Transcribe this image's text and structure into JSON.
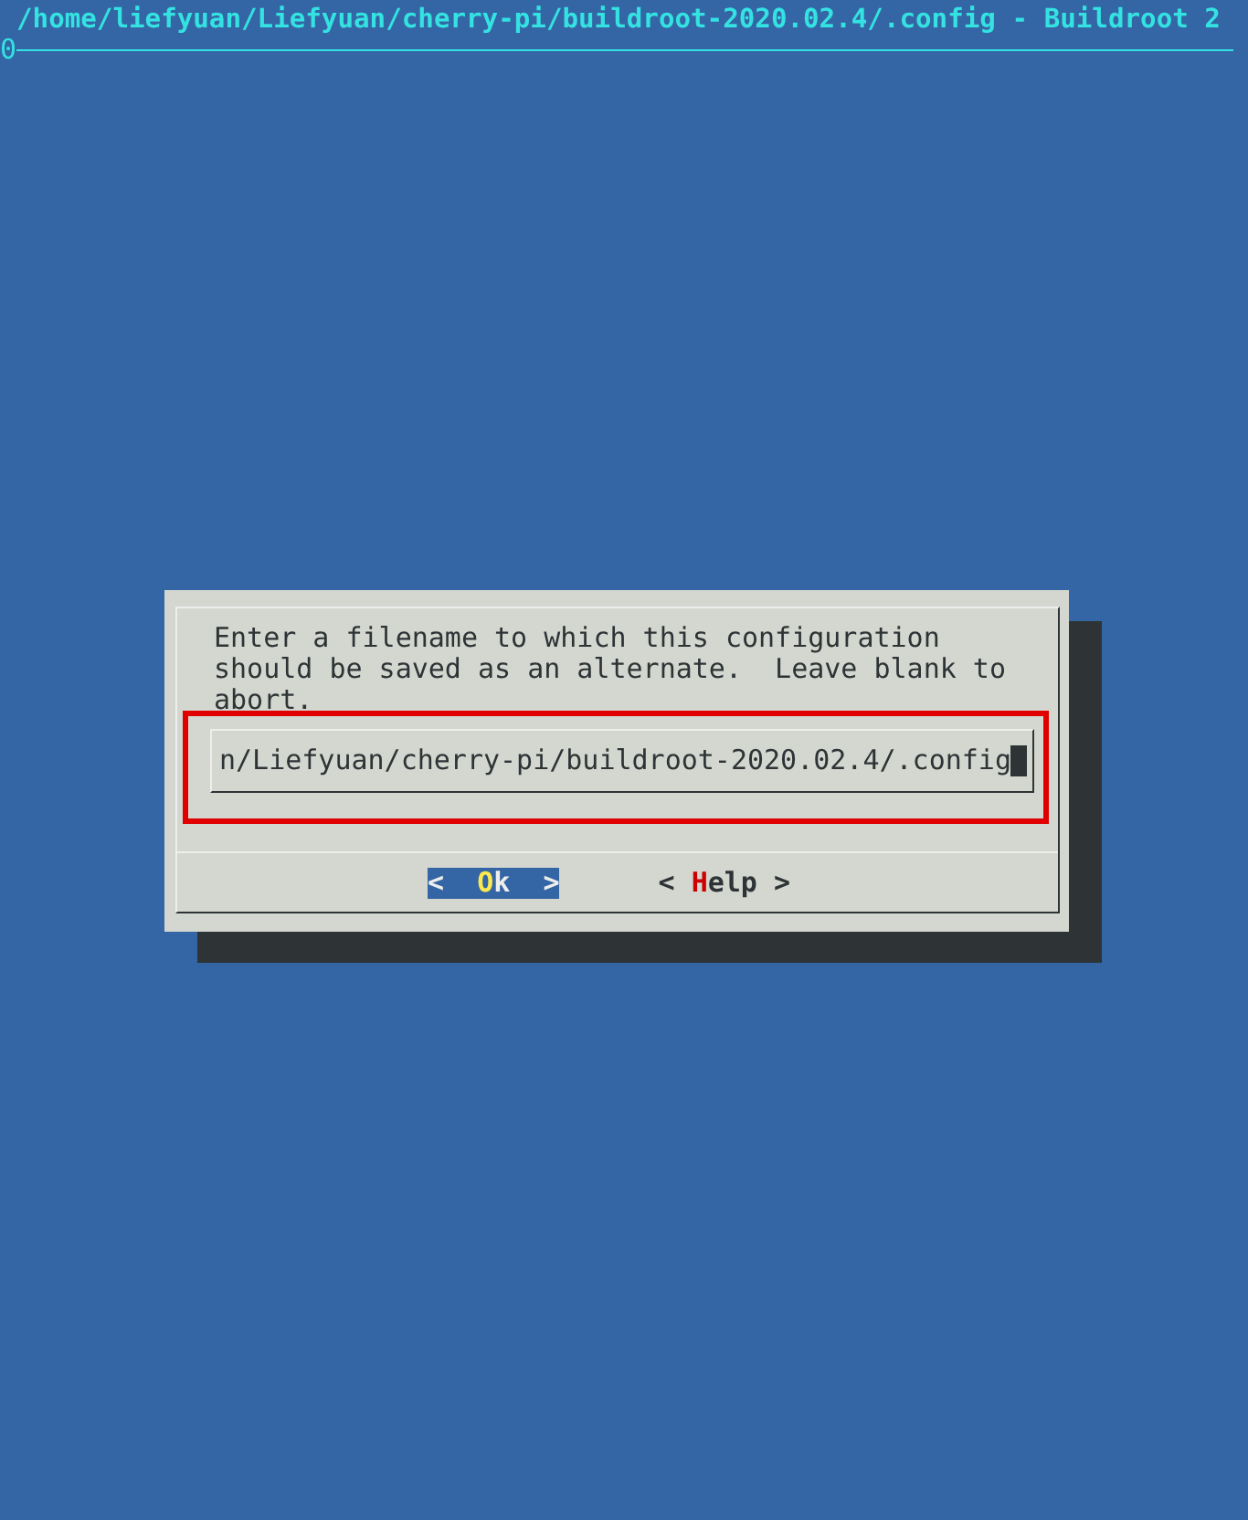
{
  "window": {
    "title": "/home/liefyuan/Liefyuan/cherry-pi/buildroot-2020.02.4/.config - Buildroot 2",
    "subtitle": "0"
  },
  "dialog": {
    "prompt": "Enter a filename to which this configuration should be saved as an alternate.  Leave blank to abort.",
    "field": {
      "value": "n/Liefyuan/cherry-pi/buildroot-2020.02.4/.config",
      "focused": true
    },
    "buttons": [
      {
        "open": "<",
        "label": "Ok",
        "close": ">",
        "selected": true
      },
      {
        "open": "<",
        "label": "Help",
        "close": ">",
        "selected": false
      }
    ]
  }
}
